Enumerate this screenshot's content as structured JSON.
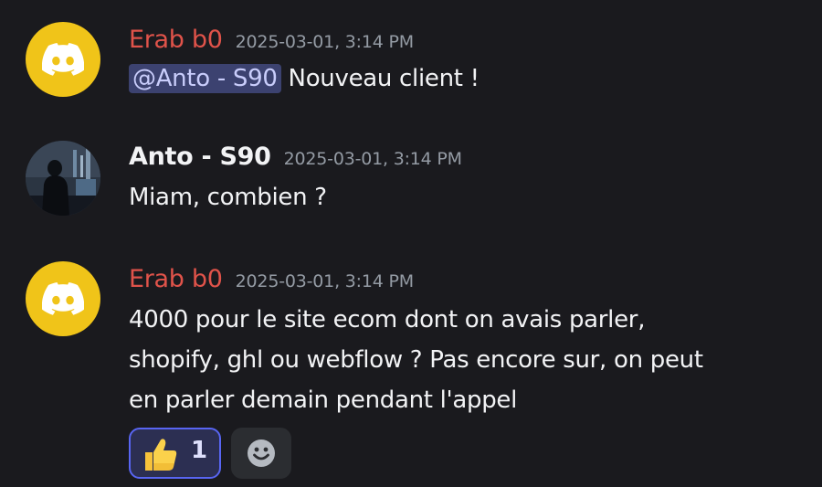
{
  "messages": [
    {
      "username": "Erab b0",
      "timestamp": "2025-03-01, 3:14 PM",
      "mention": "@Anto - S90",
      "text": " Nouveau client !",
      "avatar_icon": "discord-logo-icon"
    },
    {
      "username": "Anto - S90",
      "timestamp": "2025-03-01, 3:14 PM",
      "text": "Miam, combien ?",
      "avatar_icon": "user-photo"
    },
    {
      "username": "Erab b0",
      "timestamp": "2025-03-01, 3:14 PM",
      "lines": [
        "4000 pour le site ecom dont on avais parler,",
        "shopify, ghl ou webflow ? Pas encore sur, on peut",
        "en parler demain pendant l'appel"
      ],
      "avatar_icon": "discord-logo-icon",
      "reactions": [
        {
          "emoji": "thumbs-up-icon",
          "count": "1"
        }
      ],
      "add_reaction_icon": "smiley-face-icon"
    }
  ],
  "colors": {
    "background": "#1a1a1e",
    "bot_name": "#e0534a",
    "discord_avatar": "#f0c419",
    "mention_bg": "#3c4270",
    "reaction_border": "#5865f2"
  }
}
